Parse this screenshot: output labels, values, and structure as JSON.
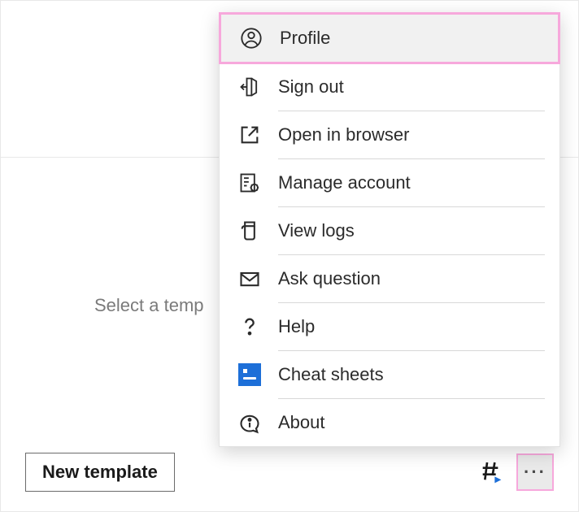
{
  "placeholder": "Select a temp",
  "bottom": {
    "new_template": "New template"
  },
  "menu": {
    "profile": "Profile",
    "signout": "Sign out",
    "open_browser": "Open in browser",
    "manage_account": "Manage account",
    "view_logs": "View logs",
    "ask_question": "Ask question",
    "help": "Help",
    "cheat_sheets": "Cheat sheets",
    "about": "About"
  }
}
